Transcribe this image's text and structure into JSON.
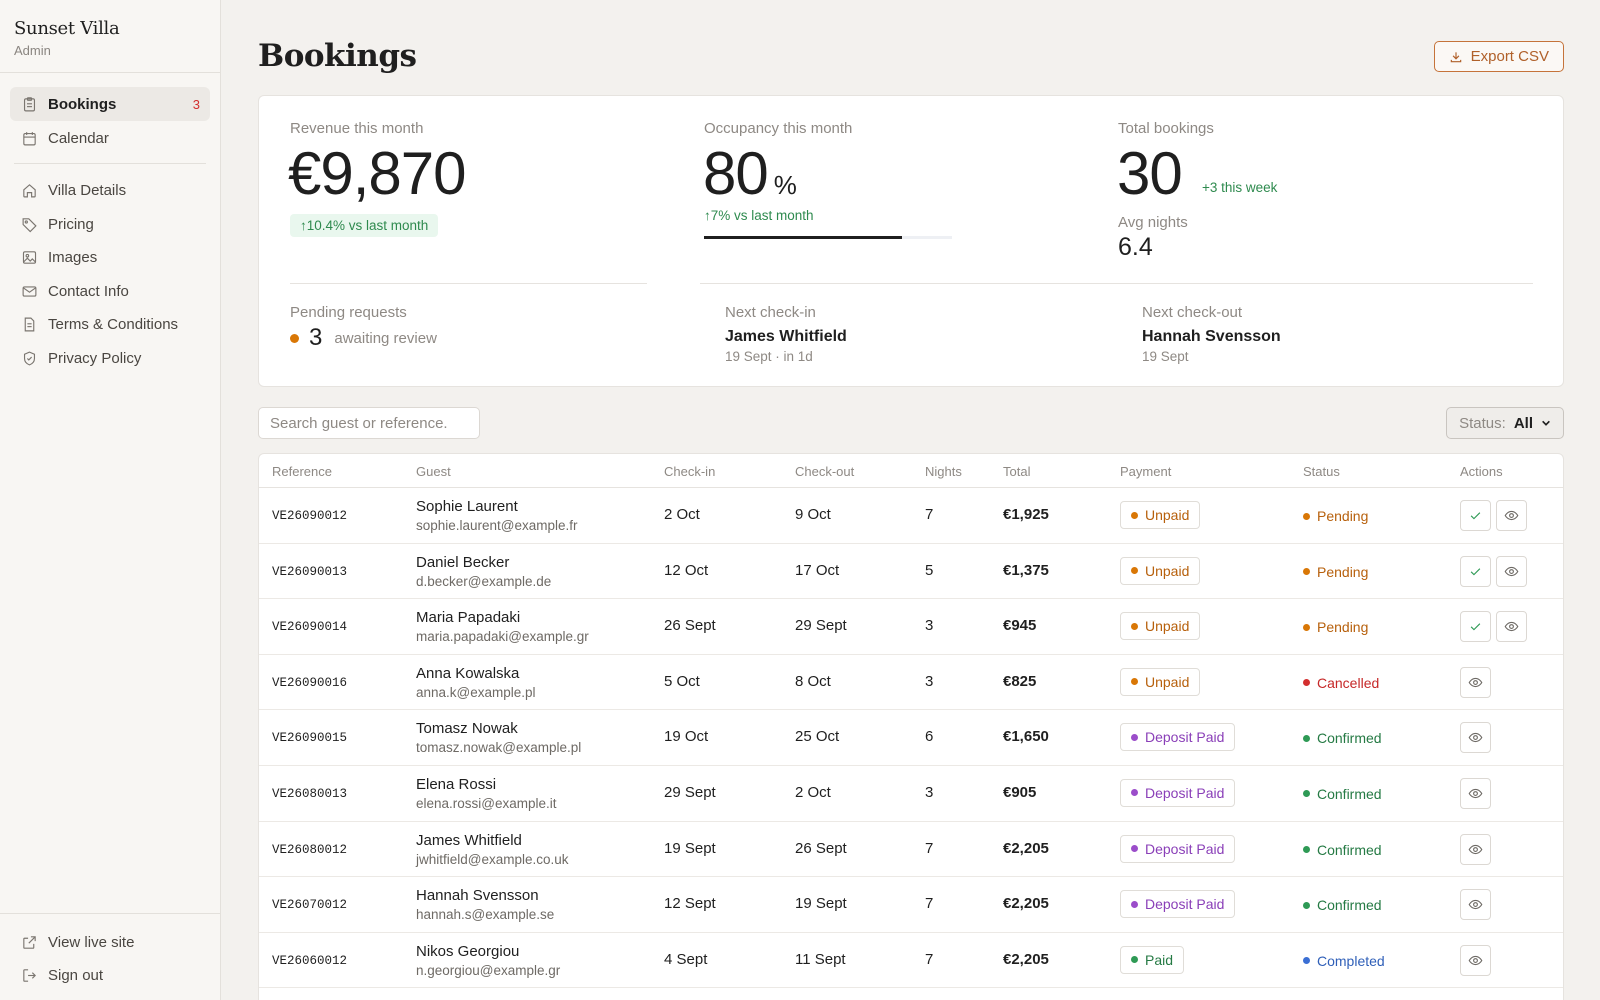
{
  "sidebar": {
    "brand": "Sunset Villa",
    "role": "Admin",
    "primary": [
      {
        "label": "Bookings",
        "badge": "3",
        "icon": "clipboard-icon"
      },
      {
        "label": "Calendar",
        "icon": "calendar-icon"
      }
    ],
    "secondary": [
      {
        "label": "Villa Details",
        "icon": "home-icon"
      },
      {
        "label": "Pricing",
        "icon": "tag-icon"
      },
      {
        "label": "Images",
        "icon": "image-icon"
      },
      {
        "label": "Contact Info",
        "icon": "mail-icon"
      },
      {
        "label": "Terms & Conditions",
        "icon": "document-icon"
      },
      {
        "label": "Privacy Policy",
        "icon": "shield-icon"
      }
    ],
    "bottom": [
      {
        "label": "View live site",
        "icon": "external-link-icon"
      },
      {
        "label": "Sign out",
        "icon": "sign-out-icon"
      }
    ]
  },
  "header": {
    "title": "Bookings",
    "export_label": "Export CSV"
  },
  "stats": {
    "revenue": {
      "label": "Revenue this month",
      "value": "€9,870",
      "change": "↑10.4% vs last month"
    },
    "occupancy": {
      "label": "Occupancy this month",
      "value": "80",
      "unit": "%",
      "change": "↑7% vs last month",
      "fill_fraction": 0.8
    },
    "total": {
      "label": "Total bookings",
      "value": "30",
      "week": "+3 this week",
      "avg_label": "Avg nights",
      "avg_value": "6.4"
    },
    "pending": {
      "label": "Pending requests",
      "value": "3",
      "note": "awaiting review"
    },
    "next_checkin": {
      "label": "Next check-in",
      "name": "James Whitfield",
      "meta": "19 Sept · in 1d"
    },
    "next_checkout": {
      "label": "Next check-out",
      "name": "Hannah Svensson",
      "meta": "19 Sept"
    }
  },
  "toolbar": {
    "search_placeholder": "Search guest or reference.",
    "status_label": "Status:",
    "status_value": "All"
  },
  "colors": {
    "accent": "#c5733a",
    "unpaid": "#d97706",
    "deposit": "#9b4dca",
    "paid": "#2e9a55",
    "pending": "#d97706",
    "cancelled": "#d32f2f",
    "confirmed": "#2e9a55",
    "completed": "#3b6fd4"
  },
  "table": {
    "columns": [
      "Reference",
      "Guest",
      "Check-in",
      "Check-out",
      "Nights",
      "Total",
      "Payment",
      "Status",
      "Actions"
    ],
    "rows": [
      {
        "ref": "VE26090012",
        "name": "Sophie Laurent",
        "email": "sophie.laurent@example.fr",
        "checkin": "2 Oct",
        "checkout": "9 Oct",
        "nights": "7",
        "total": "€1,925",
        "payment": "Unpaid",
        "status": "Pending"
      },
      {
        "ref": "VE26090013",
        "name": "Daniel Becker",
        "email": "d.becker@example.de",
        "checkin": "12 Oct",
        "checkout": "17 Oct",
        "nights": "5",
        "total": "€1,375",
        "payment": "Unpaid",
        "status": "Pending"
      },
      {
        "ref": "VE26090014",
        "name": "Maria Papadaki",
        "email": "maria.papadaki@example.gr",
        "checkin": "26 Sept",
        "checkout": "29 Sept",
        "nights": "3",
        "total": "€945",
        "payment": "Unpaid",
        "status": "Pending"
      },
      {
        "ref": "VE26090016",
        "name": "Anna Kowalska",
        "email": "anna.k@example.pl",
        "checkin": "5 Oct",
        "checkout": "8 Oct",
        "nights": "3",
        "total": "€825",
        "payment": "Unpaid",
        "status": "Cancelled"
      },
      {
        "ref": "VE26090015",
        "name": "Tomasz Nowak",
        "email": "tomasz.nowak@example.pl",
        "checkin": "19 Oct",
        "checkout": "25 Oct",
        "nights": "6",
        "total": "€1,650",
        "payment": "Deposit Paid",
        "status": "Confirmed"
      },
      {
        "ref": "VE26080013",
        "name": "Elena Rossi",
        "email": "elena.rossi@example.it",
        "checkin": "29 Sept",
        "checkout": "2 Oct",
        "nights": "3",
        "total": "€905",
        "payment": "Deposit Paid",
        "status": "Confirmed"
      },
      {
        "ref": "VE26080012",
        "name": "James Whitfield",
        "email": "jwhitfield@example.co.uk",
        "checkin": "19 Sept",
        "checkout": "26 Sept",
        "nights": "7",
        "total": "€2,205",
        "payment": "Deposit Paid",
        "status": "Confirmed"
      },
      {
        "ref": "VE26070012",
        "name": "Hannah Svensson",
        "email": "hannah.s@example.se",
        "checkin": "12 Sept",
        "checkout": "19 Sept",
        "nights": "7",
        "total": "€2,205",
        "payment": "Deposit Paid",
        "status": "Confirmed"
      },
      {
        "ref": "VE26060012",
        "name": "Nikos Georgiou",
        "email": "n.georgiou@example.gr",
        "checkin": "4 Sept",
        "checkout": "11 Sept",
        "nights": "7",
        "total": "€2,205",
        "payment": "Paid",
        "status": "Completed"
      }
    ]
  }
}
